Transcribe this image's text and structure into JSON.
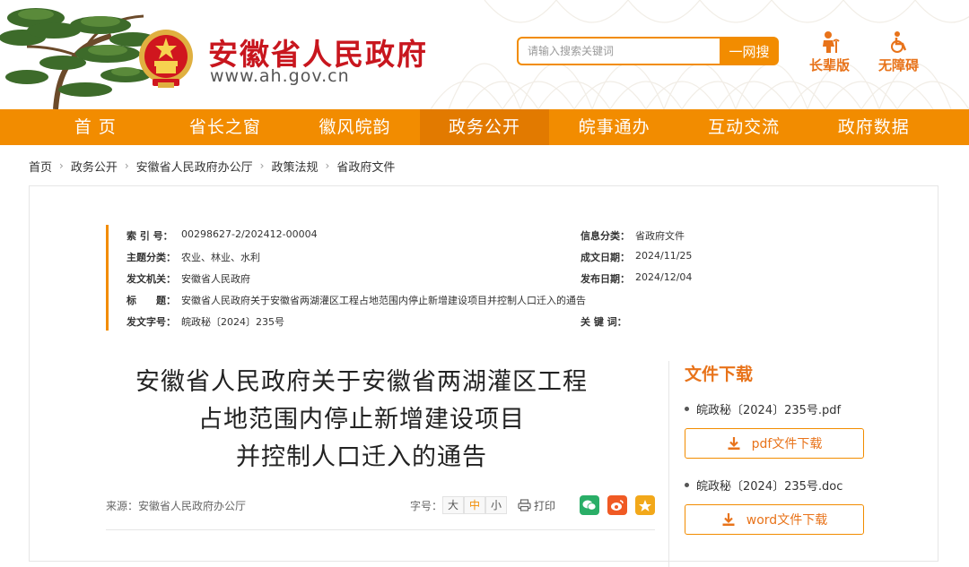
{
  "header": {
    "site_title": "安徽省人民政府",
    "site_url": "www.ah.gov.cn",
    "search_placeholder": "请输入搜索关键词",
    "search_button": "一网搜",
    "elder_label": "长辈版",
    "access_label": "无障碍"
  },
  "nav": {
    "items": [
      "首 页",
      "省长之窗",
      "徽风皖韵",
      "政务公开",
      "皖事通办",
      "互动交流",
      "政府数据"
    ],
    "active": "政务公开"
  },
  "breadcrumb": [
    "首页",
    "政务公开",
    "安徽省人民政府办公厅",
    "政策法规",
    "省政府文件"
  ],
  "meta": {
    "index_label": "索 引 号：",
    "index_value": "00298627-2/202412-00004",
    "category_label": "信息分类：",
    "category_value": "省政府文件",
    "topic_label": "主题分类：",
    "topic_value": "农业、林业、水利",
    "created_label": "成文日期：",
    "created_value": "2024/11/25",
    "issuer_label": "发文机关：",
    "issuer_value": "安徽省人民政府",
    "published_label": "发布日期：",
    "published_value": "2024/12/04",
    "title_label": "标　　题：",
    "title_value": "安徽省人民政府关于安徽省两湖灌区工程占地范围内停止新增建设项目并控制人口迁入的通告",
    "docno_label": "发文字号：",
    "docno_value": "皖政秘〔2024〕235号",
    "keywords_label": "关 键 词："
  },
  "article": {
    "title_line1": "安徽省人民政府关于安徽省两湖灌区工程",
    "title_line2": "占地范围内停止新增建设项目",
    "title_line3": "并控制人口迁入的通告",
    "source": "来源：安徽省人民政府办公厅",
    "fontsize_label": "字号：",
    "fontsize_large": "大",
    "fontsize_medium": "中",
    "fontsize_small": "小",
    "print_label": "打印"
  },
  "downloads": {
    "title": "文件下载",
    "pdf_name": "皖政秘〔2024〕235号.pdf",
    "pdf_button": "pdf文件下载",
    "doc_name": "皖政秘〔2024〕235号.doc",
    "doc_button": "word文件下载"
  },
  "colors": {
    "brand_orange": "#f28c00",
    "title_red": "#c8161e"
  }
}
